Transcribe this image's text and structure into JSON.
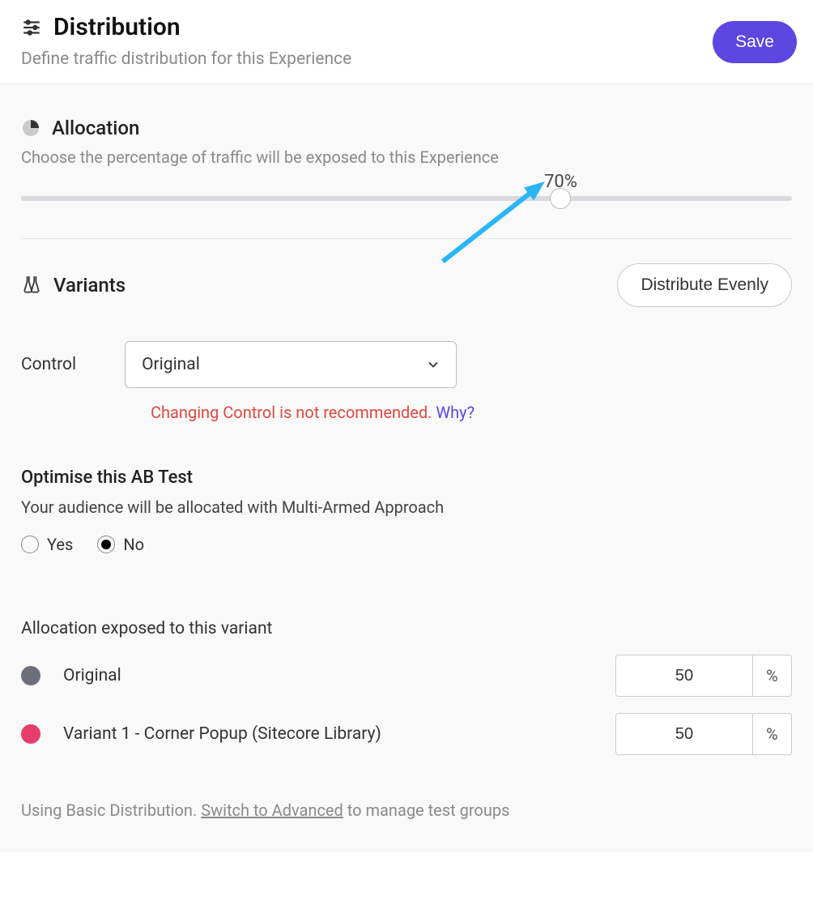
{
  "header": {
    "title": "Distribution",
    "subtitle": "Define traffic distribution for this Experience",
    "save_label": "Save"
  },
  "allocation": {
    "title": "Allocation",
    "description": "Choose the percentage of traffic will be exposed to this Experience",
    "value": 70,
    "value_display": "70%"
  },
  "variants": {
    "title": "Variants",
    "distribute_label": "Distribute Evenly",
    "control_label": "Control",
    "control_selected": "Original",
    "warning": "Changing Control is not recommended.",
    "why_label": "Why?"
  },
  "optimise": {
    "title": "Optimise this AB Test",
    "description": "Your audience will be allocated with Multi-Armed Approach",
    "options": {
      "yes": "Yes",
      "no": "No"
    },
    "selected": "No"
  },
  "allocation_table": {
    "title": "Allocation exposed to this variant",
    "rows": [
      {
        "color": "#6b6e78",
        "name": "Original",
        "value": "50"
      },
      {
        "color": "#e83e6b",
        "name": "Variant 1 - Corner Popup (Sitecore Library)",
        "value": "50"
      }
    ],
    "unit": "%"
  },
  "footer": {
    "prefix": "Using Basic Distribution. ",
    "link": "Switch to Advanced",
    "suffix": " to manage test groups"
  }
}
